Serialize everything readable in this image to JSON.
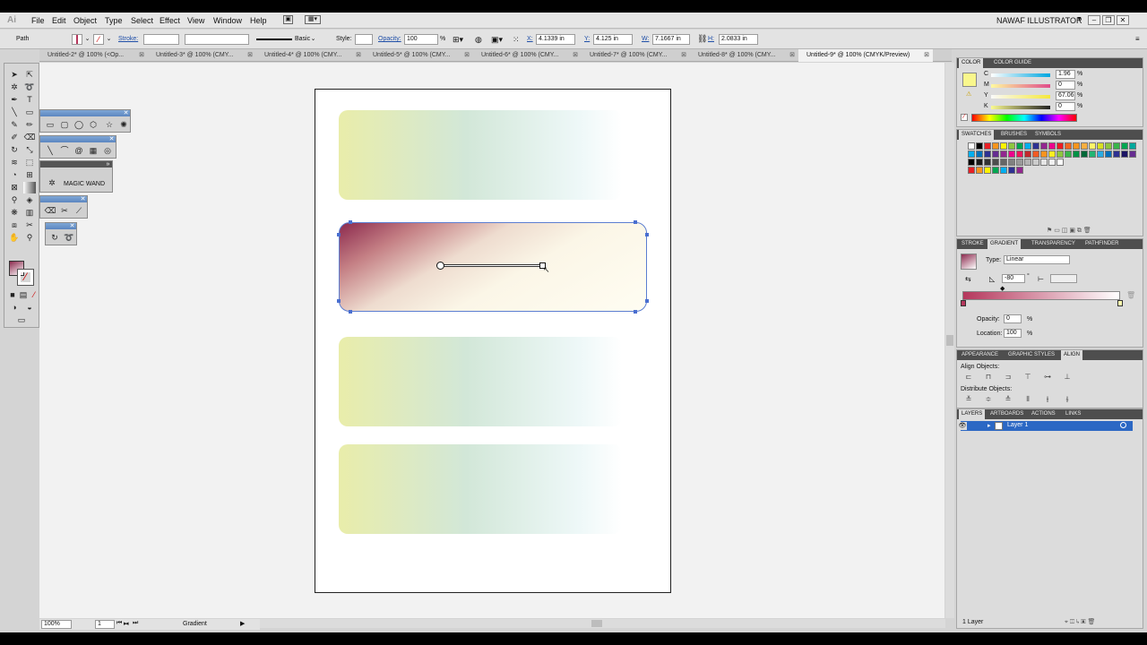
{
  "app": {
    "logo": "Ai",
    "workspace": "NAWAF ILLUSTRATOR"
  },
  "menu": [
    "File",
    "Edit",
    "Object",
    "Type",
    "Select",
    "Effect",
    "View",
    "Window",
    "Help"
  ],
  "control_bar": {
    "selection_type": "Path",
    "stroke_label": "Stroke:",
    "brush_label": "Basic",
    "style_label": "Style:",
    "opacity_label": "Opacity:",
    "opacity_value": "100",
    "opacity_unit": "%",
    "x_label": "X:",
    "x_value": "4.1339 in",
    "y_label": "Y:",
    "y_value": "4.125 in",
    "w_label": "W:",
    "w_value": "7.1667 in",
    "h_label": "H:",
    "h_value": "2.0833 in"
  },
  "tabs": [
    "Untitled-2* @ 100% (<Op...",
    "Untitled-3* @ 100% (CMY...",
    "Untitled-4* @ 100% (CMY...",
    "Untitled-5* @ 100% (CMY...",
    "Untitled-6* @ 100% (CMY...",
    "Untitled-7* @ 100% (CMY...",
    "Untitled-8* @ 100% (CMY...",
    "Untitled-9* @ 100% (CMYK/Preview)"
  ],
  "tab_close": "⊠",
  "floating": {
    "magic_wand": "MAGIC WAND"
  },
  "status": {
    "zoom": "100%",
    "artboard": "1",
    "tool": "Gradient"
  },
  "color_panel": {
    "tabs": [
      "COLOR",
      "COLOR GUIDE"
    ],
    "channels": [
      {
        "label": "C",
        "value": "1.96",
        "unit": "%"
      },
      {
        "label": "M",
        "value": "0",
        "unit": "%"
      },
      {
        "label": "Y",
        "value": "67.06",
        "unit": "%"
      },
      {
        "label": "K",
        "value": "0",
        "unit": "%"
      }
    ]
  },
  "swatches_panel": {
    "tabs": [
      "SWATCHES",
      "BRUSHES",
      "SYMBOLS"
    ]
  },
  "gradient_panel": {
    "tabs": [
      "STROKE",
      "GRADIENT",
      "TRANSPARENCY",
      "PATHFINDER"
    ],
    "type_label": "Type:",
    "type_value": "Linear",
    "angle": "-80",
    "angle_unit": "°",
    "opacity_label": "Opacity:",
    "opacity_value": "0",
    "location_label": "Location:",
    "location_value": "100",
    "percent": "%"
  },
  "align_panel": {
    "tabs": [
      "APPEARANCE",
      "GRAPHIC STYLES",
      "ALIGN"
    ],
    "align_objects": "Align Objects:",
    "distribute_objects": "Distribute Objects:"
  },
  "layers_panel": {
    "tabs": [
      "LAYERS",
      "ARTBOARDS",
      "ACTIONS",
      "LINKS"
    ],
    "layer_name": "Layer 1",
    "count": "1 Layer"
  },
  "colors": {
    "fill_swatch": "#f9f78c",
    "selection": "#2c68c4",
    "gradient_start": "#8c2a4e",
    "gradient_end": "#fffdf2"
  }
}
